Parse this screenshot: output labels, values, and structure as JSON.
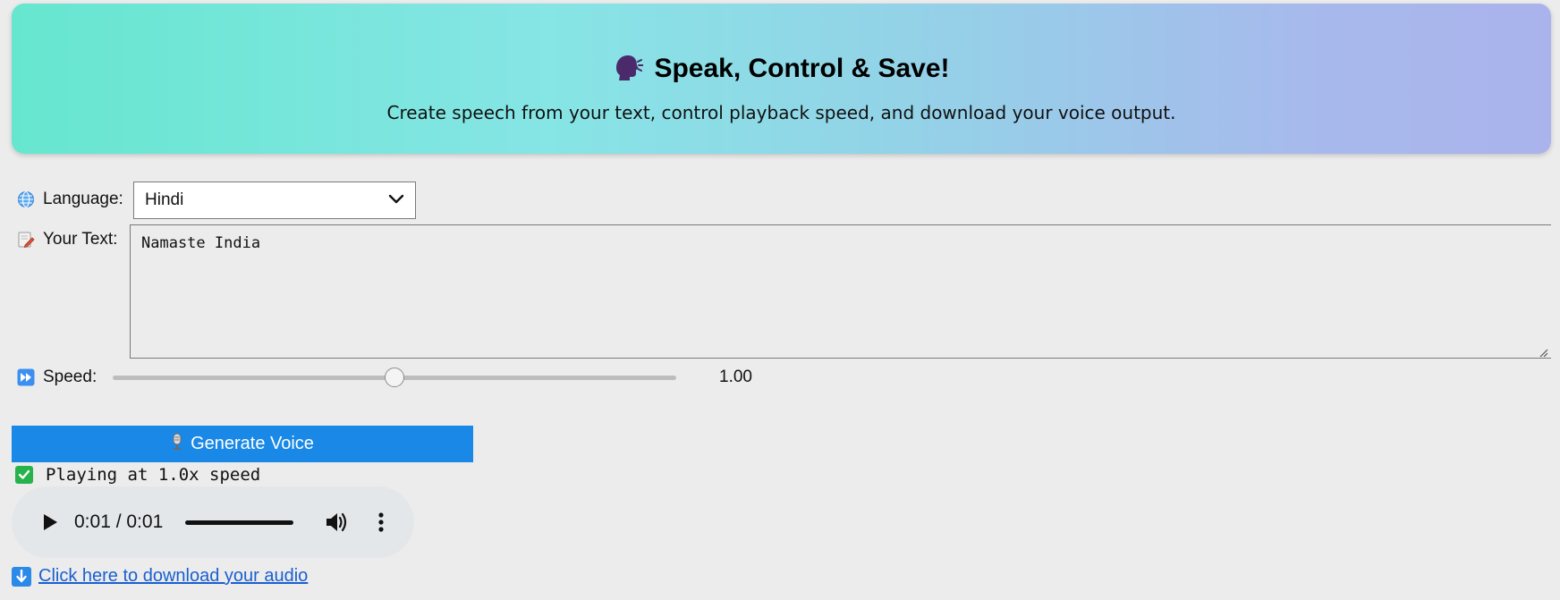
{
  "header": {
    "title": "Speak, Control & Save!",
    "subtitle": "Create speech from your text, control playback speed, and download your voice output."
  },
  "language": {
    "label": "Language:",
    "selected": "Hindi",
    "icon": "globe-icon"
  },
  "text": {
    "label": "Your Text:",
    "value": "Namaste India",
    "icon": "pencil-memo-icon"
  },
  "speed": {
    "label": "Speed:",
    "value": 1.0,
    "display": "1.00",
    "min": 0.5,
    "max": 1.5,
    "icon": "fast-forward-icon"
  },
  "generate": {
    "label": "Generate Voice",
    "icon": "microphone-icon",
    "color": "#1a88e6"
  },
  "status": {
    "text": "Playing at 1.0x speed",
    "icon": "check-mark-icon",
    "color": "#27b34b"
  },
  "audio": {
    "time": "0:01 / 0:01",
    "progress": 1.0
  },
  "download": {
    "label": "Click here to download your audio",
    "icon": "down-arrow-icon"
  }
}
